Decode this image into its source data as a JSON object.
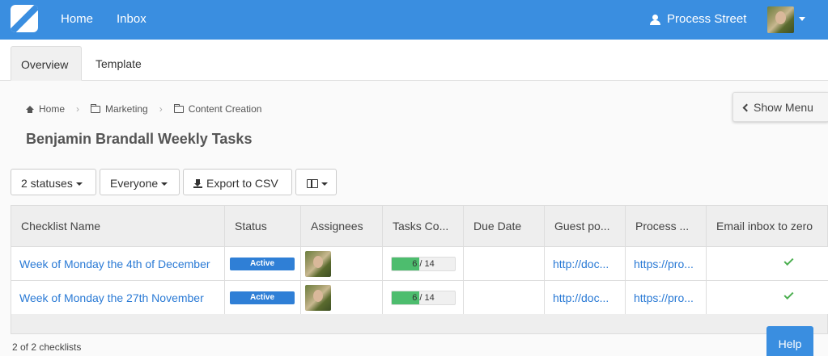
{
  "nav": {
    "home": "Home",
    "inbox": "Inbox",
    "org": "Process Street",
    "org_icon": "users-icon",
    "logo_icon": "process-street-logo"
  },
  "tabs": [
    {
      "label": "Overview",
      "active": true
    },
    {
      "label": "Template",
      "active": false
    }
  ],
  "breadcrumb": [
    {
      "label": "Home",
      "icon": "home-icon"
    },
    {
      "label": "Marketing",
      "icon": "folder-icon"
    },
    {
      "label": "Content Creation",
      "icon": "folder-icon"
    }
  ],
  "page_title": "Benjamin Brandall Weekly Tasks",
  "show_menu_label": "Show Menu",
  "toolbar": {
    "statuses": "2 statuses",
    "assignee": "Everyone",
    "export": "Export to CSV"
  },
  "table": {
    "columns": [
      "Checklist Name",
      "Status",
      "Assignees",
      "Tasks Co...",
      "Due Date",
      "Guest po...",
      "Process ...",
      "Email inbox to zero"
    ],
    "rows": [
      {
        "name": "Week of Monday the 4th of December",
        "status": "Active",
        "tasks_done": 6,
        "tasks_total": 14,
        "progress_fraction": 0.43,
        "due_date": "",
        "guest_post": "http://doc...",
        "process": "https://pro...",
        "email_inbox_done": true
      },
      {
        "name": "Week of Monday the 27th November",
        "status": "Active",
        "tasks_done": 6,
        "tasks_total": 14,
        "progress_fraction": 0.43,
        "due_date": "",
        "guest_post": "http://doc...",
        "process": "https://pro...",
        "email_inbox_done": true
      }
    ]
  },
  "footer_count": "2 of 2 checklists",
  "help_label": "Help",
  "colors": {
    "nav_bg": "#3a8ee0",
    "status_active": "#2f7fd6",
    "progress_fill": "#4dbd6e",
    "link": "#2a7ad5",
    "check": "#4caf50"
  }
}
